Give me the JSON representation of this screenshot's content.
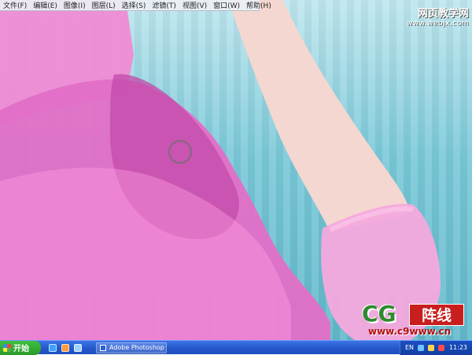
{
  "menubar": {
    "items": [
      "文件(F)",
      "编辑(E)",
      "图像(I)",
      "图层(L)",
      "选择(S)",
      "滤镜(T)",
      "视图(V)",
      "窗口(W)",
      "帮助(H)"
    ]
  },
  "watermark_top": {
    "title": "网页教学网",
    "url": "www.webjx.com"
  },
  "watermark_cg": {
    "brand": "CG",
    "tag": "阵线",
    "url": "www.c9www.cn"
  },
  "taskbar": {
    "start_label": "开始",
    "task_label": "Adobe Photoshop",
    "tray_lang": "EN",
    "time": "11:23"
  },
  "colors": {
    "bg_light": "#bfe6ee",
    "bg_dark": "#5fb7c9",
    "dress_pink": "#e36fc7",
    "dress_dark": "#c14aa9",
    "skin": "#f4d7d0",
    "glove": "#f6a9dd",
    "taskbar_blue": "#2456c8",
    "start_green": "#2a9a2a"
  }
}
